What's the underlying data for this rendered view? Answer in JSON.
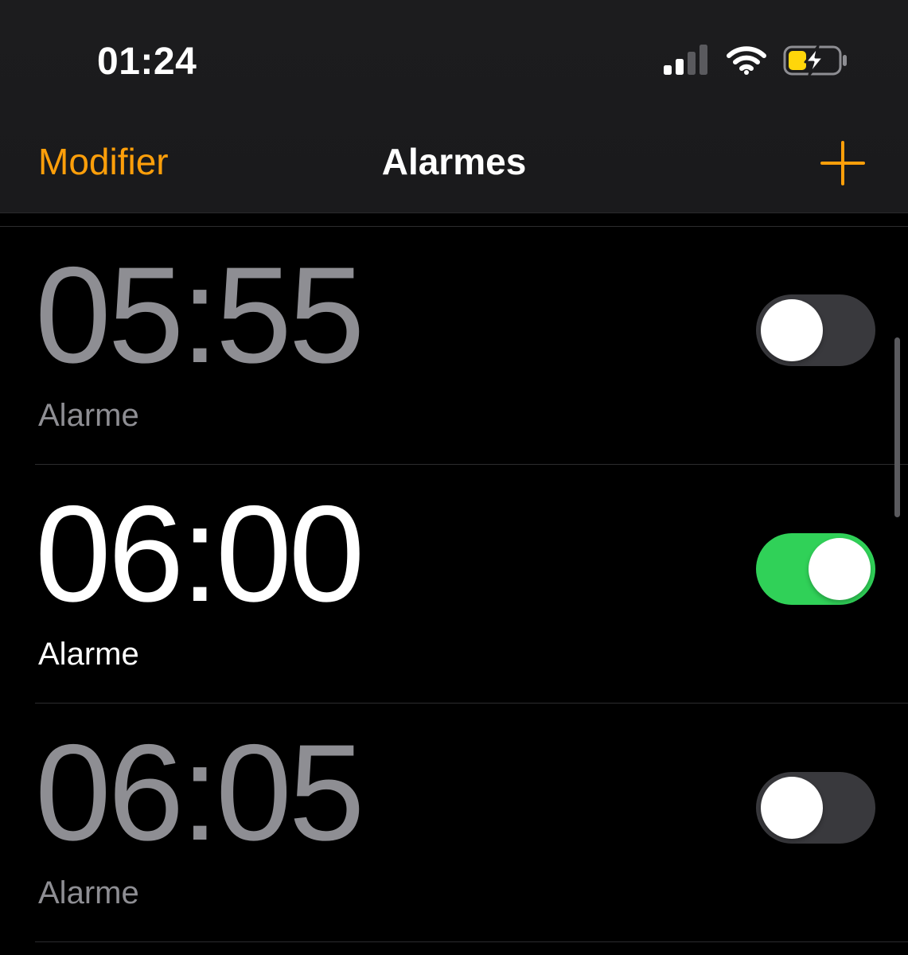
{
  "status_bar": {
    "time": "01:24",
    "icons": [
      "cellular-signal-icon",
      "wifi-icon",
      "battery-charging-icon"
    ],
    "battery_color": "#ffd60a"
  },
  "nav": {
    "edit_label": "Modifier",
    "title": "Alarmes",
    "add_icon": "plus-icon",
    "accent_color": "#ff9f0a"
  },
  "alarms": [
    {
      "time": "05:55",
      "label": "Alarme",
      "enabled": false
    },
    {
      "time": "06:00",
      "label": "Alarme",
      "enabled": true
    },
    {
      "time": "06:05",
      "label": "Alarme",
      "enabled": false
    }
  ],
  "colors": {
    "toggle_on": "#30d158",
    "toggle_off": "#39393d",
    "inactive_text": "#8e8e93"
  }
}
